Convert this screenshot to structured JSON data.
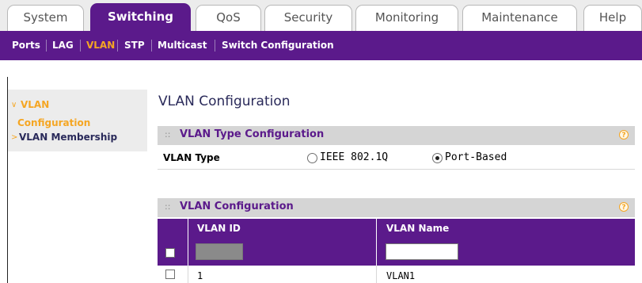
{
  "tabs": [
    {
      "label": "System",
      "active": false
    },
    {
      "label": "Switching",
      "active": true
    },
    {
      "label": "QoS",
      "active": false
    },
    {
      "label": "Security",
      "active": false
    },
    {
      "label": "Monitoring",
      "active": false
    },
    {
      "label": "Maintenance",
      "active": false
    },
    {
      "label": "Help",
      "active": false
    }
  ],
  "subnav": [
    {
      "label": "Ports",
      "active": false
    },
    {
      "label": "LAG",
      "active": false
    },
    {
      "label": "VLAN",
      "active": true
    },
    {
      "label": "STP",
      "active": false
    },
    {
      "label": "Multicast",
      "active": false
    },
    {
      "label": "Switch Configuration",
      "active": false
    }
  ],
  "leftmenu": {
    "items": [
      {
        "label_line1": "VLAN",
        "label_line2": "Configuration",
        "active": true,
        "bullet": "∨"
      },
      {
        "label_line1": "VLAN Membership",
        "active": false,
        "bullet": ">"
      }
    ]
  },
  "page": {
    "title": "VLAN Configuration"
  },
  "type_section": {
    "title": "VLAN Type Configuration",
    "help": "?",
    "dots": "::",
    "field_label": "VLAN Type",
    "options": [
      {
        "label": "IEEE 802.1Q",
        "selected": false
      },
      {
        "label": "Port-Based",
        "selected": true
      }
    ]
  },
  "config_section": {
    "title": "VLAN Configuration",
    "help": "?",
    "dots": "::",
    "columns": [
      "VLAN ID",
      "VLAN Name"
    ],
    "input_row": {
      "vlan_id": "",
      "vlan_name": ""
    },
    "rows": [
      {
        "vlan_id": "1",
        "vlan_name": "VLAN1",
        "checked": false
      }
    ]
  },
  "colors": {
    "accent": "#5b1a8b",
    "highlight": "#f5a623",
    "section_bg": "#d5d5d5"
  }
}
